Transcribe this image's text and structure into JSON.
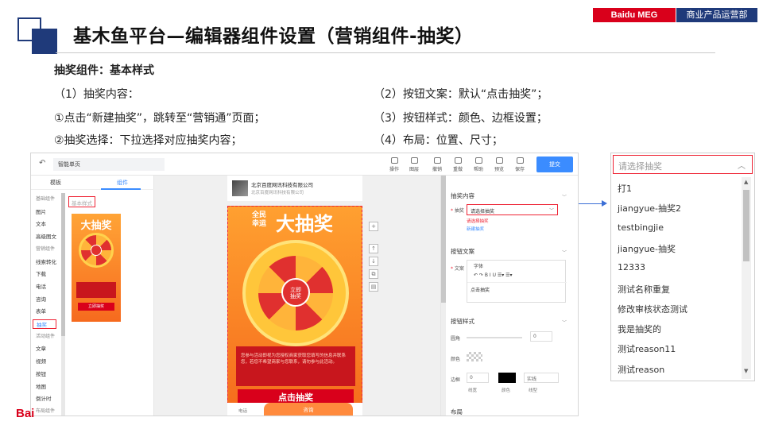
{
  "header": {
    "title": "基木鱼平台—编辑器组件设置（营销组件-抽奖）",
    "brand_left": "Baidu MEG",
    "brand_right": "商业产品运营部"
  },
  "content": {
    "subtitle": "抽奖组件：基本样式",
    "left_lines": [
      "（1）抽奖内容：",
      "①点击“新建抽奖”，跳转至“营销通”页面；",
      "②抽奖选择：下拉选择对应抽奖内容；"
    ],
    "right_lines": [
      "（2）按钮文案：默认“点击抽奖”；",
      "（3）按钮样式：颜色、边框设置；",
      "（4）布局：位置、尺寸；"
    ]
  },
  "editor": {
    "back": "↶",
    "page_name": "智能单页",
    "tools": [
      "操作",
      "图层",
      "撤销",
      "重做",
      "帮助",
      "预览",
      "保存"
    ],
    "submit": "提交",
    "tabs": [
      "模板",
      "组件"
    ],
    "categories": [
      {
        "label": "基础组件",
        "group": true
      },
      {
        "label": "图片"
      },
      {
        "label": "文本"
      },
      {
        "label": "高级图文"
      },
      {
        "label": "营销组件",
        "group": true
      },
      {
        "label": "线索转化"
      },
      {
        "label": "下载"
      },
      {
        "label": "电话"
      },
      {
        "label": "咨询"
      },
      {
        "label": "表单"
      },
      {
        "label": "抽奖",
        "selected": true
      },
      {
        "label": "活动组件",
        "group": true
      },
      {
        "label": "文章"
      },
      {
        "label": "视频"
      },
      {
        "label": "按钮"
      },
      {
        "label": "地图"
      },
      {
        "label": "倒计时"
      },
      {
        "label": "布局组件",
        "group": true
      }
    ],
    "basic_style_tag": "基本样式",
    "thumb": {
      "title": "大抽奖",
      "button": "立即抽奖"
    },
    "phone": {
      "company": "北京百度网讯科技有限公司",
      "company_sub": "北京百度网讯科技有限公司",
      "title_small": "全民\n幸运",
      "title_big": "大抽奖",
      "center": "立即\n抽奖",
      "desc": "您参与活动即视为您授权商家获取您填写的信息并联系您，若您不希望商家与您联系，请勿参与此活动。",
      "button": "点击抽奖",
      "foot_left": "电话",
      "foot_right": "咨询"
    },
    "side_tools": [
      "+",
      "↑",
      "↓",
      "⧉",
      "▤"
    ],
    "right": {
      "section1": "抽奖内容",
      "draw_label": "抽奖",
      "draw_placeholder": "请选择抽奖",
      "error": "请选择抽奖",
      "new_link": "新建抽奖",
      "section2": "按钮文案",
      "text_label": "文案",
      "font_label": "字体",
      "rte_tools": "↶  ↷  B  I  U  ☰▾  ☰▾",
      "btn_text": "点击抽奖",
      "section3": "按钮样式",
      "radius_label": "圆角",
      "radius_value": "0",
      "color_label": "颜色",
      "border_label": "边框",
      "border_width": "0",
      "border_style": "实线",
      "sub_width": "线宽",
      "sub_color": "颜色",
      "sub_style": "线型",
      "section4": "布局"
    }
  },
  "dropdown": {
    "placeholder": "请选择抽奖",
    "items": [
      "打1",
      "jiangyue-抽奖2",
      "testbingjie",
      "jiangyue-抽奖",
      "12333",
      "测试名称重复",
      "修改审核状态测试",
      "我是抽奖的",
      "测试reason11",
      "测试reason"
    ]
  },
  "footer": {
    "logo": "Bai"
  },
  "colors": {
    "brand_red": "#d9001b",
    "brand_blue": "#1f3a7a",
    "accent": "#3b8cff"
  }
}
